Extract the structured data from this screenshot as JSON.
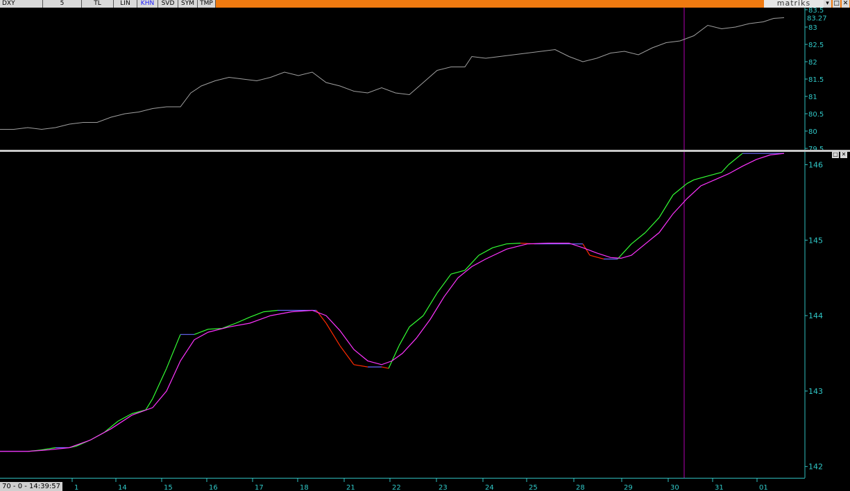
{
  "toolbar": {
    "symbol": "DXY",
    "period": "5",
    "buttons": [
      "TL",
      "LIN",
      "KHN",
      "SVD",
      "SYM",
      "TMP"
    ],
    "active_button": "KHN",
    "brand": "matriks"
  },
  "window_buttons": [
    "▾",
    "□",
    "✕"
  ],
  "panel_buttons": [
    "□",
    "✕"
  ],
  "status": {
    "clock": "70 - 0 - 14:39:57"
  },
  "colors": {
    "background": "#000000",
    "price_line": "#a0a0a0",
    "axis": "#2fbfbf",
    "tick_text": "#30c8c8",
    "up_segment": "#33ff33",
    "down_segment": "#ff2a00",
    "flat_segment": "#6a6aff",
    "signal_line": "#ff33ff",
    "cursor_line": "#b000b0",
    "toolbar": "#f07a10"
  },
  "chart_data": [
    {
      "type": "line",
      "series": [
        {
          "x": [
            0,
            20,
            40,
            60,
            80,
            100,
            120,
            140,
            160,
            180,
            200,
            220,
            240,
            260,
            275,
            290,
            310,
            330,
            350,
            370,
            390,
            410,
            430,
            450,
            470,
            490,
            510,
            530,
            550,
            570,
            590,
            610,
            630,
            650,
            670,
            680,
            700,
            720,
            740,
            760,
            780,
            800,
            820,
            840,
            860,
            880,
            900,
            920,
            940,
            960,
            980,
            1000,
            1020,
            1040,
            1060,
            1080,
            1100,
            1115,
            1130
          ],
          "values": [
            80.05,
            80.05,
            80.1,
            80.05,
            80.1,
            80.2,
            80.25,
            80.25,
            80.4,
            80.5,
            80.55,
            80.65,
            80.7,
            80.7,
            81.1,
            81.3,
            81.45,
            81.55,
            81.5,
            81.45,
            81.55,
            81.7,
            81.6,
            81.7,
            81.4,
            81.3,
            81.15,
            81.1,
            81.25,
            81.1,
            81.05,
            81.4,
            81.75,
            81.85,
            81.85,
            82.15,
            82.1,
            82.15,
            82.2,
            82.25,
            82.3,
            82.35,
            82.15,
            82.0,
            82.1,
            82.25,
            82.3,
            82.2,
            82.4,
            82.55,
            82.6,
            82.75,
            83.05,
            82.95,
            83.0,
            83.1,
            83.15,
            83.25,
            83.27
          ]
        }
      ],
      "ylim": [
        79.5,
        83.5
      ],
      "yticks": [
        "83.5",
        "83",
        "82.5",
        "82",
        "81.5",
        "81",
        "80.5",
        "80",
        "79.5"
      ],
      "last_value": "83.27"
    },
    {
      "type": "line",
      "ylim": [
        141.85,
        146.17
      ],
      "yticks": [
        "146",
        "145",
        "144",
        "143",
        "142"
      ],
      "xtick_labels": [
        "1",
        "14",
        "15",
        "16",
        "17",
        "18",
        "21",
        "22",
        "23",
        "24",
        "25",
        "28",
        "29",
        "30",
        "31",
        "01"
      ],
      "series": [
        {
          "x": [
            0,
            20,
            40,
            60,
            80,
            100,
            110,
            130,
            150,
            170,
            190,
            210,
            220,
            240,
            260,
            280,
            300,
            320,
            340,
            360,
            380,
            400,
            420,
            440,
            456,
            470,
            490,
            510,
            530,
            550,
            560,
            565,
            575,
            590,
            610,
            630,
            650,
            670,
            690,
            710,
            730,
            750,
            770,
            790,
            810,
            830,
            840,
            850,
            870,
            890,
            910,
            930,
            950,
            970,
            990,
            1000,
            1020,
            1040,
            1050,
            1070,
            1090,
            1110,
            1130
          ],
          "values": [
            142.2,
            142.2,
            142.2,
            142.22,
            142.25,
            142.25,
            142.27,
            142.35,
            142.45,
            142.6,
            142.7,
            142.75,
            142.9,
            143.3,
            143.75,
            143.75,
            143.82,
            143.83,
            143.9,
            143.98,
            144.05,
            144.07,
            144.07,
            144.07,
            144.07,
            143.9,
            143.6,
            143.35,
            143.32,
            143.32,
            143.3,
            143.4,
            143.6,
            143.85,
            144.0,
            144.3,
            144.55,
            144.6,
            144.8,
            144.9,
            144.95,
            144.96,
            144.95,
            144.95,
            144.95,
            144.95,
            144.95,
            144.8,
            144.75,
            144.75,
            144.95,
            145.1,
            145.3,
            145.6,
            145.75,
            145.8,
            145.85,
            145.9,
            146.0,
            146.15,
            146.15,
            146.15,
            146.15
          ]
        },
        {
          "x": [
            0,
            40,
            70,
            100,
            130,
            160,
            190,
            220,
            240,
            260,
            280,
            300,
            330,
            360,
            390,
            420,
            450,
            470,
            490,
            510,
            530,
            550,
            565,
            580,
            600,
            620,
            640,
            660,
            680,
            700,
            730,
            760,
            790,
            820,
            840,
            860,
            880,
            895,
            910,
            930,
            950,
            970,
            990,
            1010,
            1030,
            1050,
            1070,
            1090,
            1110,
            1130
          ],
          "values": [
            142.2,
            142.2,
            142.22,
            142.25,
            142.35,
            142.5,
            142.68,
            142.78,
            143.0,
            143.4,
            143.68,
            143.78,
            143.85,
            143.9,
            144.0,
            144.05,
            144.07,
            144.0,
            143.8,
            143.55,
            143.4,
            143.35,
            143.4,
            143.5,
            143.7,
            143.95,
            144.25,
            144.5,
            144.65,
            144.75,
            144.88,
            144.95,
            144.96,
            144.96,
            144.9,
            144.83,
            144.77,
            144.76,
            144.8,
            144.95,
            145.1,
            145.35,
            145.55,
            145.72,
            145.8,
            145.88,
            145.98,
            146.07,
            146.13,
            146.15
          ]
        }
      ]
    }
  ]
}
